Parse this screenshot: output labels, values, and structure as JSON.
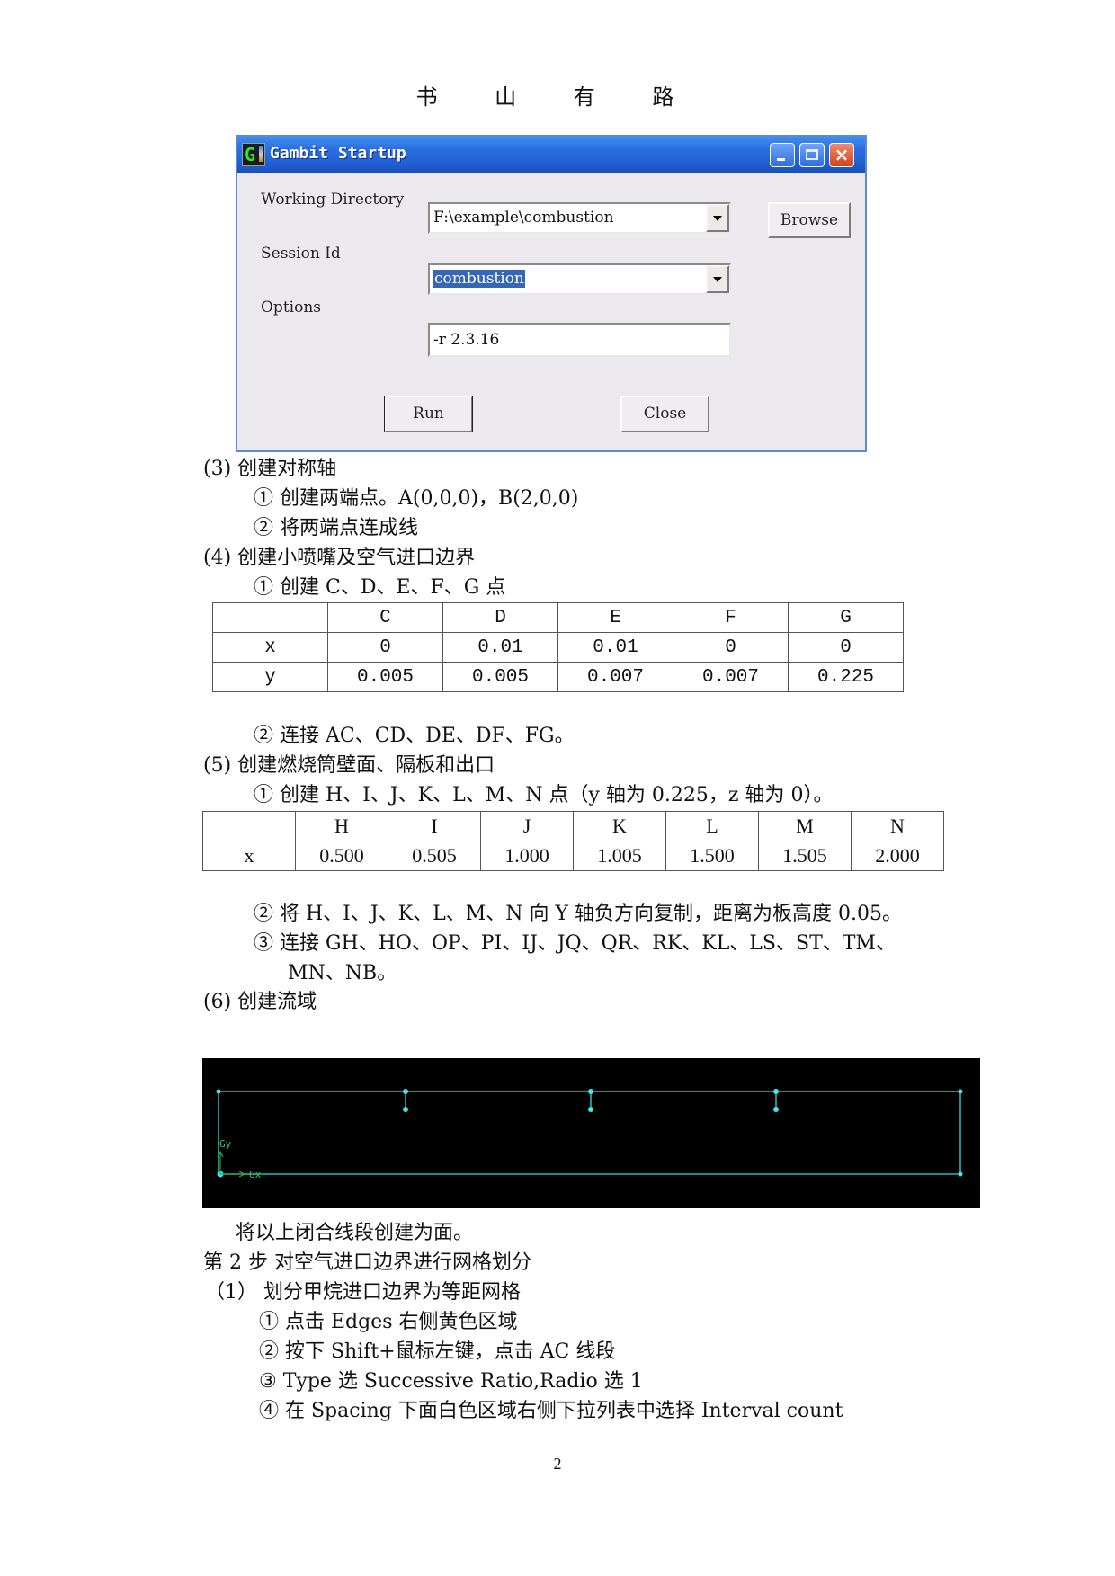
{
  "header": {
    "text": "书 山 有 路"
  },
  "dialog": {
    "title": "Gambit Startup",
    "icon": "gambit-app-icon",
    "title_buttons": {
      "minimize": "minimize-icon",
      "maximize": "maximize-icon",
      "close": "×"
    },
    "fields": [
      {
        "label": "Working Directory",
        "value": "F:\\example\\combustion",
        "type": "combo"
      },
      {
        "label": "Session Id",
        "value": "combustion",
        "type": "combo",
        "selected": true
      },
      {
        "label": "Options",
        "value": "-r 2.3.16",
        "type": "text"
      }
    ],
    "browse_label": "Browse",
    "run_label": "Run",
    "close_label": "Close"
  },
  "sections": {
    "s3": {
      "title": "(3) 创建对称轴",
      "items": [
        "① 创建两端点。A(0,0,0)，B(2,0,0)",
        "② 将两端点连成线"
      ]
    },
    "s4": {
      "title": "(4) 创建小喷嘴及空气进口边界",
      "item1": "① 创建 C、D、E、F、G 点",
      "table": {
        "headers": [
          "",
          "C",
          "D",
          "E",
          "F",
          "G"
        ],
        "rows": [
          [
            "x",
            "0",
            "0.01",
            "0.01",
            "0",
            "0"
          ],
          [
            "y",
            "0.005",
            "0.005",
            "0.007",
            "0.007",
            "0.225"
          ]
        ]
      },
      "item2": "② 连接 AC、CD、DE、DF、FG。"
    },
    "s5": {
      "title": "(5) 创建燃烧筒壁面、隔板和出口",
      "item1": "① 创建 H、I、J、K、L、M、N 点（y 轴为 0.225，z 轴为 0）。",
      "table": {
        "headers": [
          "",
          "H",
          "I",
          "J",
          "K",
          "L",
          "M",
          "N"
        ],
        "rows": [
          [
            "x",
            "0.500",
            "0.505",
            "1.000",
            "1.005",
            "1.500",
            "1.505",
            "2.000"
          ]
        ]
      },
      "item2": "② 将 H、I、J、K、L、M、N 向 Y 轴负方向复制，距离为板高度 0.05。",
      "item3a": "③ 连接 GH、HO、OP、PI、IJ、JQ、QR、RK、KL、LS、ST、TM、",
      "item3b": "MN、NB。"
    },
    "s6": {
      "title": "(6) 创建流域"
    },
    "geometry": {
      "axis_x_label": "Gx",
      "axis_y_label": "Gy",
      "line_color": "#2ab5b5",
      "point_color": "#3fe6f0"
    },
    "after_geo": "将以上闭合线段创建为面。",
    "step2": {
      "title": "第 2 步  对空气进口边界进行网格划分",
      "sub": "（1）  划分甲烷进口边界为等距网格",
      "items": [
        "① 点击 Edges 右侧黄色区域",
        "② 按下 Shift+鼠标左键，点击 AC 线段",
        "③ Type 选 Successive Ratio,Radio  选 1",
        "④ 在 Spacing 下面白色区域右侧下拉列表中选择 Interval count"
      ]
    }
  },
  "page_number": "2"
}
